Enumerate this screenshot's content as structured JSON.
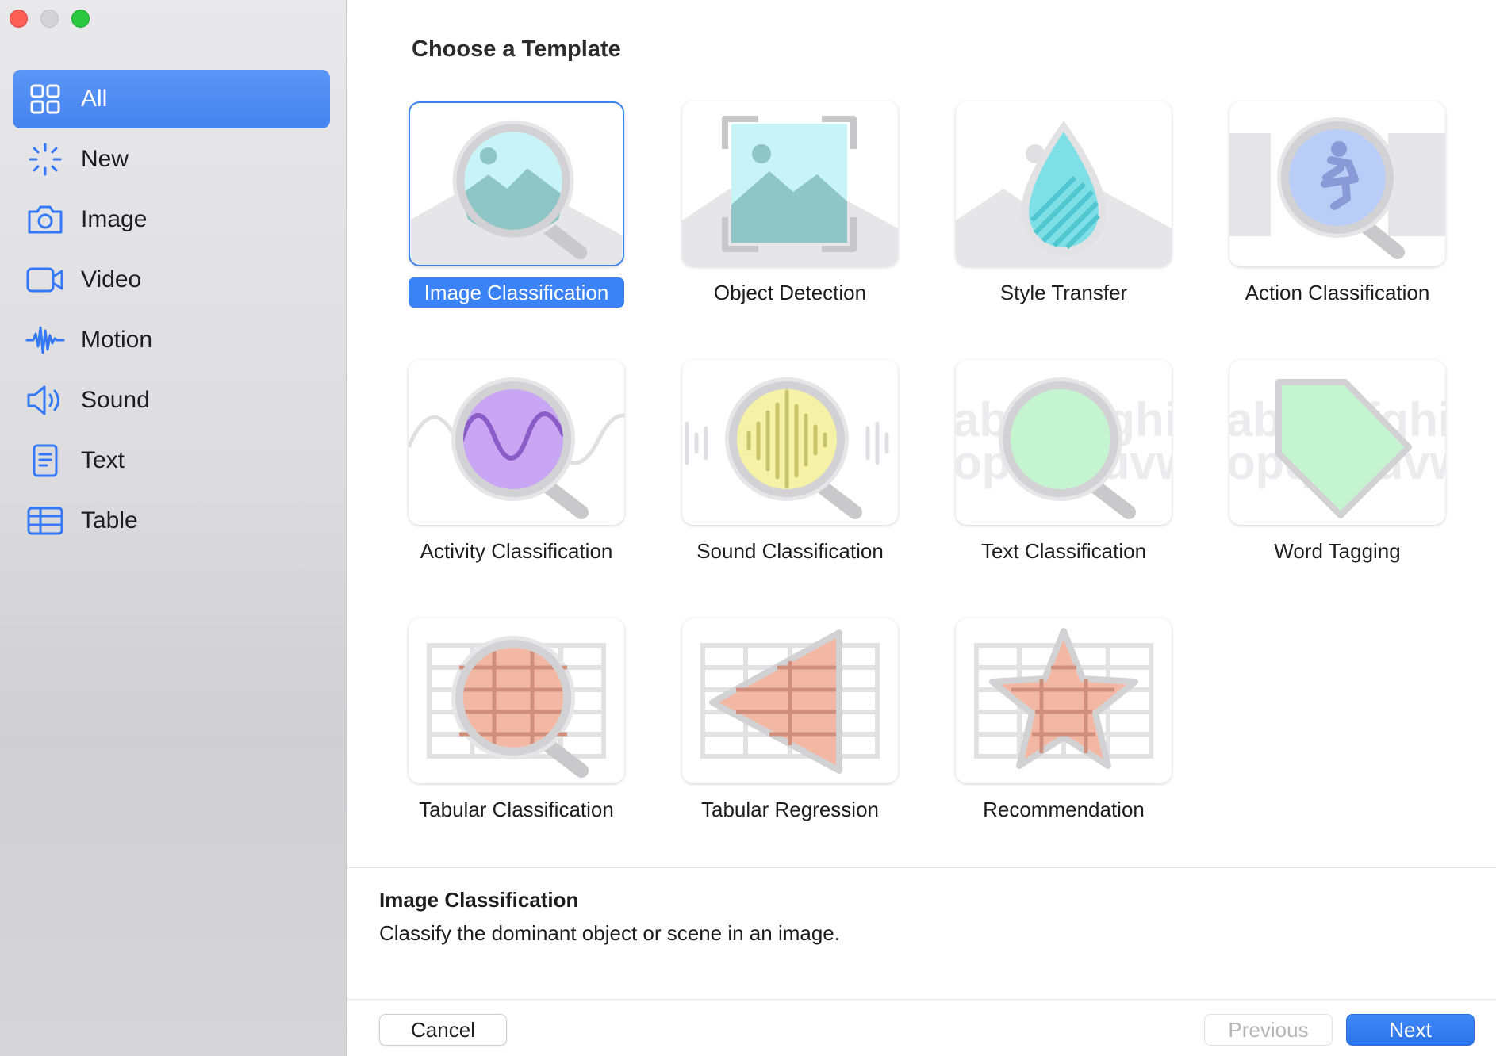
{
  "sidebar": {
    "items": [
      {
        "label": "All",
        "icon": "grid-icon",
        "active": true
      },
      {
        "label": "New",
        "icon": "sparkle-icon",
        "active": false
      },
      {
        "label": "Image",
        "icon": "camera-icon",
        "active": false
      },
      {
        "label": "Video",
        "icon": "video-camera-icon",
        "active": false
      },
      {
        "label": "Motion",
        "icon": "waveform-icon",
        "active": false
      },
      {
        "label": "Sound",
        "icon": "speaker-icon",
        "active": false
      },
      {
        "label": "Text",
        "icon": "document-icon",
        "active": false
      },
      {
        "label": "Table",
        "icon": "table-icon",
        "active": false
      }
    ]
  },
  "main": {
    "heading": "Choose a Template",
    "templates": [
      {
        "label": "Image Classification",
        "selected": true
      },
      {
        "label": "Object Detection",
        "selected": false
      },
      {
        "label": "Style Transfer",
        "selected": false
      },
      {
        "label": "Action Classification",
        "selected": false
      },
      {
        "label": "Activity Classification",
        "selected": false
      },
      {
        "label": "Sound Classification",
        "selected": false
      },
      {
        "label": "Text Classification",
        "selected": false
      },
      {
        "label": "Word Tagging",
        "selected": false
      },
      {
        "label": "Tabular Classification",
        "selected": false
      },
      {
        "label": "Tabular Regression",
        "selected": false
      },
      {
        "label": "Recommendation",
        "selected": false
      }
    ],
    "thumb_letters": {
      "row1": "abcdefghi",
      "row2": "opqrstuvw"
    }
  },
  "description": {
    "title": "Image Classification",
    "text": "Classify the dominant object or scene in an image."
  },
  "footer": {
    "cancel_label": "Cancel",
    "previous_label": "Previous",
    "next_label": "Next"
  },
  "colors": {
    "accent": "#3b82f6",
    "sidebar_active": "#4f8ef5",
    "icon_blue": "#3478f6"
  }
}
